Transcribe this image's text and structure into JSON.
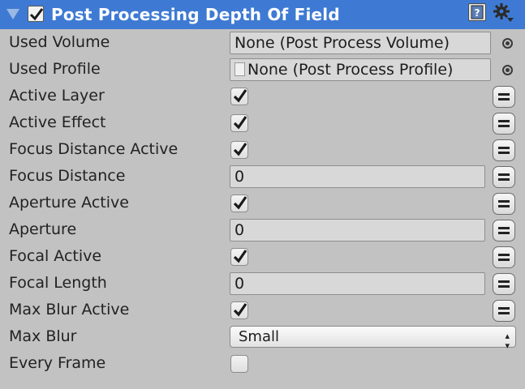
{
  "header": {
    "title": "Post Processing Depth Of Field",
    "enabled": true
  },
  "rows": {
    "used_volume": {
      "label": "Used Volume",
      "value": "None (Post Process Volume)"
    },
    "used_profile": {
      "label": "Used Profile",
      "value": "None (Post Process Profile)"
    },
    "active_layer": {
      "label": "Active Layer",
      "checked": true
    },
    "active_effect": {
      "label": "Active Effect",
      "checked": true
    },
    "focus_distance_active": {
      "label": "Focus Distance Active",
      "checked": true
    },
    "focus_distance": {
      "label": "Focus Distance",
      "value": "0"
    },
    "aperture_active": {
      "label": "Aperture Active",
      "checked": true
    },
    "aperture": {
      "label": "Aperture",
      "value": "0"
    },
    "focal_active": {
      "label": "Focal Active",
      "checked": true
    },
    "focal_length": {
      "label": "Focal Length",
      "value": "0"
    },
    "max_blur_active": {
      "label": "Max Blur Active",
      "checked": true
    },
    "max_blur": {
      "label": "Max Blur",
      "value": "Small"
    },
    "every_frame": {
      "label": "Every Frame",
      "checked": false
    }
  },
  "icons": {
    "foldout": "triangle-down-icon",
    "help": "help-book-icon",
    "settings": "gear-icon",
    "picker": "object-picker-icon",
    "binding": "binding-menu-icon",
    "checkmark": "checkmark-icon",
    "dropdown_arrows": "up-down-arrows-icon"
  },
  "colors": {
    "header_bg": "#3e7ad3",
    "panel_bg": "#c2c2c2",
    "field_bg": "#d8d8d8"
  }
}
